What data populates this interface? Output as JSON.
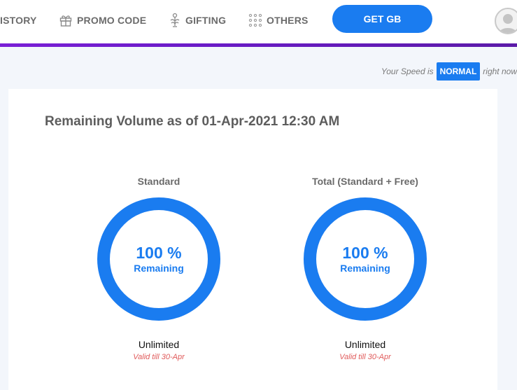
{
  "nav": {
    "history": "ISTORY",
    "promo": "PROMO CODE",
    "gifting": "GIFTING",
    "others": "OTHERS",
    "get_gb": "GET GB"
  },
  "speed": {
    "prefix": "Your Speed is",
    "badge": "NORMAL",
    "suffix": "right now"
  },
  "card": {
    "title": "Remaining Volume as of 01-Apr-2021 12:30 AM"
  },
  "meters": [
    {
      "label": "Standard",
      "percent_text": "100 %",
      "percent_value": 100,
      "sub": "Remaining",
      "volume": "Unlimited",
      "valid": "Valid till 30-Apr"
    },
    {
      "label": "Total (Standard + Free)",
      "percent_text": "100 %",
      "percent_value": 100,
      "sub": "Remaining",
      "volume": "Unlimited",
      "valid": "Valid till 30-Apr"
    }
  ],
  "colors": {
    "accent": "#1a7cf0",
    "underline": "#7a1fd6",
    "valid_text": "#e05a5a"
  },
  "icons": [
    "gift-icon",
    "gifting-icon",
    "others-grid-icon",
    "user-avatar-icon"
  ]
}
